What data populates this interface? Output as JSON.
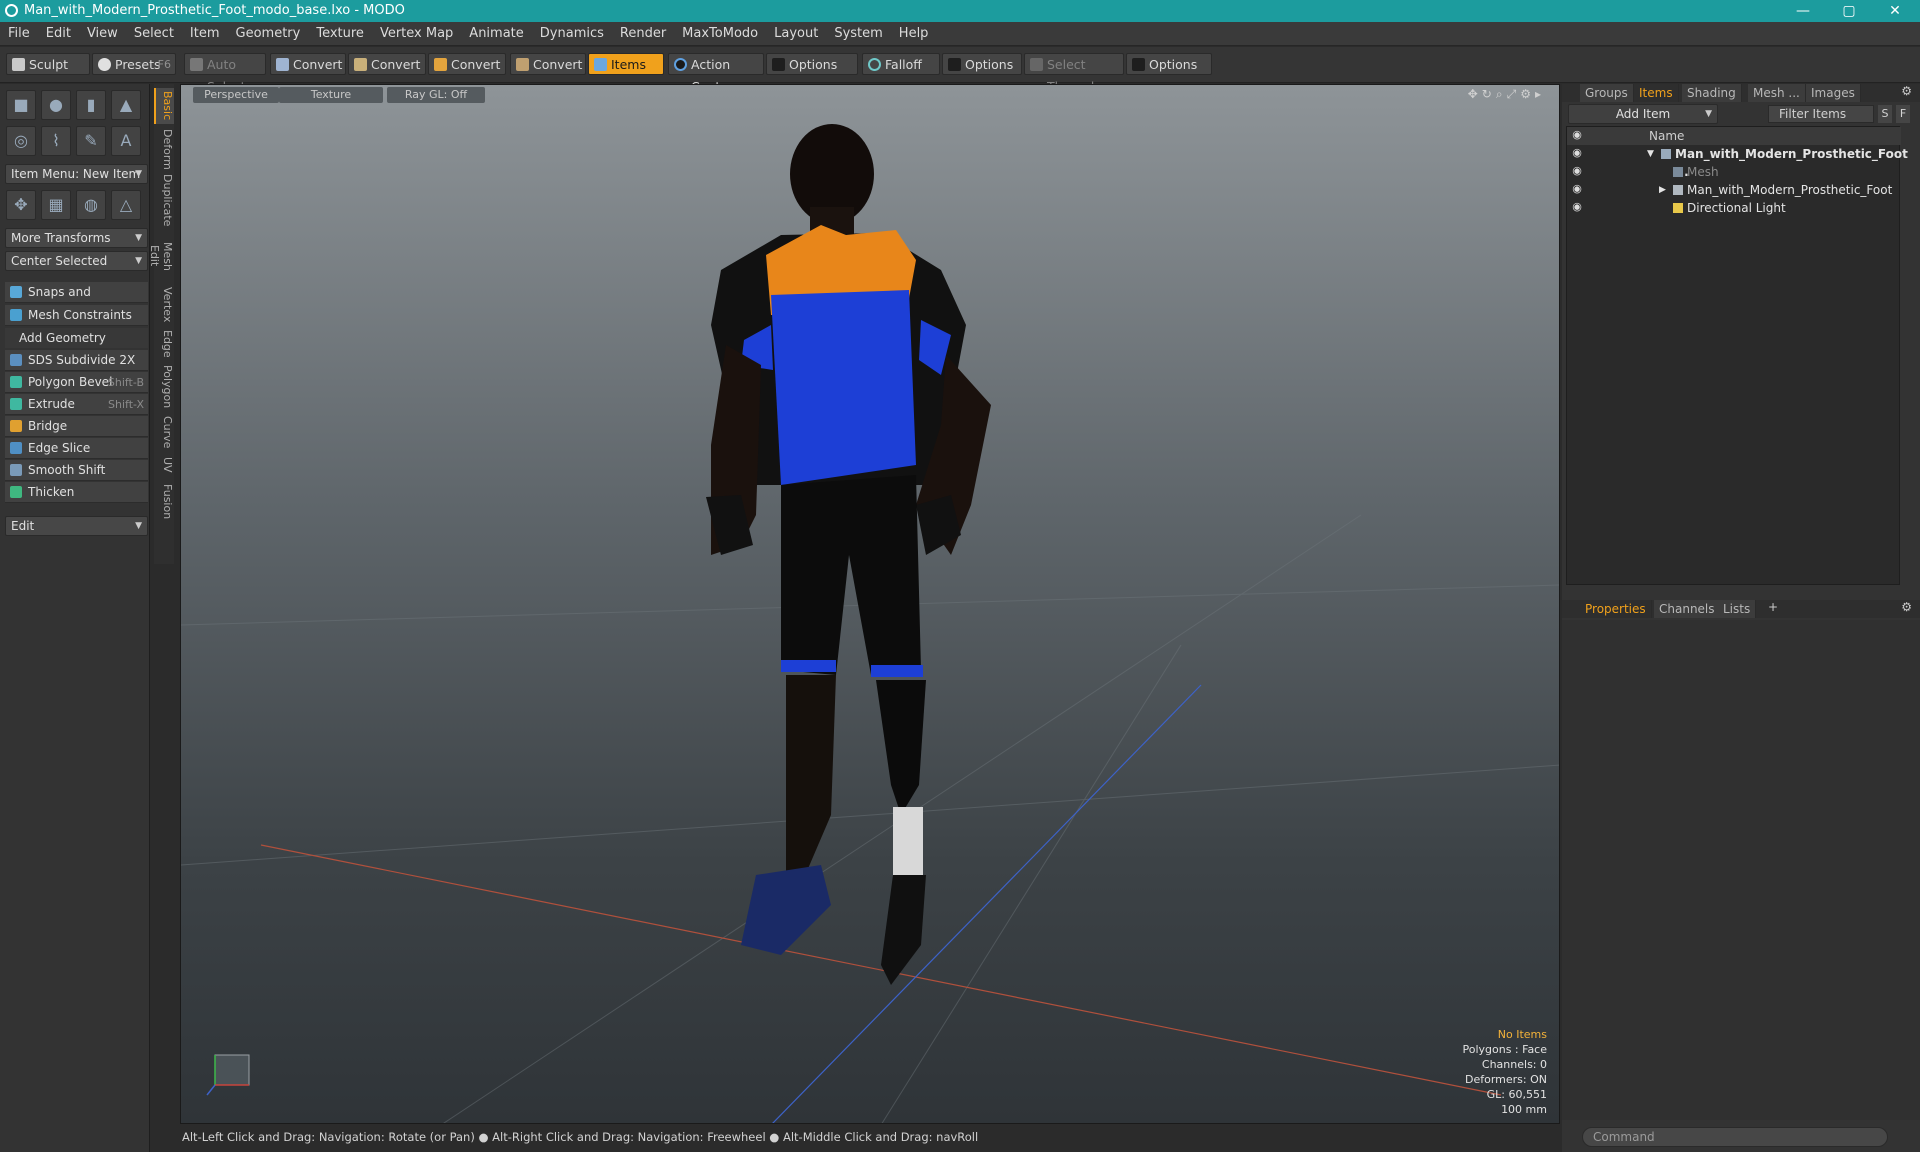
{
  "window": {
    "title": "Man_with_Modern_Prosthetic_Foot_modo_base.lxo - MODO",
    "min": "—",
    "max": "▢",
    "close": "✕"
  },
  "menu": [
    "File",
    "Edit",
    "View",
    "Select",
    "Item",
    "Geometry",
    "Texture",
    "Vertex Map",
    "Animate",
    "Dynamics",
    "Render",
    "MaxToModo",
    "Layout",
    "System",
    "Help"
  ],
  "toolbar": {
    "sculpt": "Sculpt",
    "presets": "Presets",
    "presets_hotkey": "F6",
    "auto_select": "Auto Select",
    "convert1": "Convert",
    "convert2": "Convert",
    "convert3": "Convert",
    "convert4": "Convert",
    "items": "Items",
    "action_center": "Action Center",
    "options1": "Options",
    "falloff": "Falloff",
    "options2": "Options",
    "select_through": "Select Through",
    "options3": "Options"
  },
  "left": {
    "item_menu": "Item Menu: New Item",
    "more_transforms": "More Transforms",
    "center_selected": "Center Selected",
    "snaps": "Snaps and Precision",
    "mesh_constraints": "Mesh Constraints",
    "add_geometry": "Add Geometry",
    "tools": [
      {
        "label": "SDS Subdivide 2X",
        "hotkey": ""
      },
      {
        "label": "Polygon Bevel",
        "hotkey": "Shift-B"
      },
      {
        "label": "Extrude",
        "hotkey": "Shift-X"
      },
      {
        "label": "Bridge",
        "hotkey": ""
      },
      {
        "label": "Edge Slice",
        "hotkey": ""
      },
      {
        "label": "Smooth Shift",
        "hotkey": ""
      },
      {
        "label": "Thicken",
        "hotkey": ""
      }
    ],
    "edit": "Edit"
  },
  "vtabs": [
    "Basic",
    "Deform",
    "Duplicate",
    "Mesh Edit",
    "Vertex",
    "Edge",
    "Polygon",
    "Curve",
    "UV",
    "Fusion"
  ],
  "viewport": {
    "perspective": "Perspective",
    "texture": "Texture",
    "raygl": "Ray GL: Off",
    "info": {
      "no_items": "No Items",
      "polygons": "Polygons : Face",
      "channels": "Channels: 0",
      "deformers": "Deformers: ON",
      "gl": "GL: 60,551",
      "scale": "100 mm"
    }
  },
  "status": "Alt-Left Click and Drag: Navigation: Rotate (or Pan) ● Alt-Right Click and Drag: Navigation: Freewheel ● Alt-Middle Click and Drag: navRoll",
  "right": {
    "tabs": [
      "Groups",
      "Items",
      "Shading",
      "Mesh ...",
      "Images"
    ],
    "add_item": "Add Item",
    "filter_items": "Filter Items",
    "s": "S",
    "f": "F",
    "name_col": "Name",
    "tree": [
      {
        "label": "Man_with_Modern_Prosthetic_Foot ...",
        "indent": 0
      },
      {
        "label": "Mesh",
        "indent": 1
      },
      {
        "label": "Man_with_Modern_Prosthetic_Foot",
        "indent": 1
      },
      {
        "label": "Directional Light",
        "indent": 1
      }
    ],
    "prop_tabs": [
      "Properties",
      "Channels",
      "Lists"
    ],
    "command": "Command"
  },
  "colors": {
    "accent": "#f0a11c",
    "titlebar": "#1c9c9e",
    "shirt_blue": "#1d3fd6",
    "shirt_orange": "#e8861a"
  }
}
